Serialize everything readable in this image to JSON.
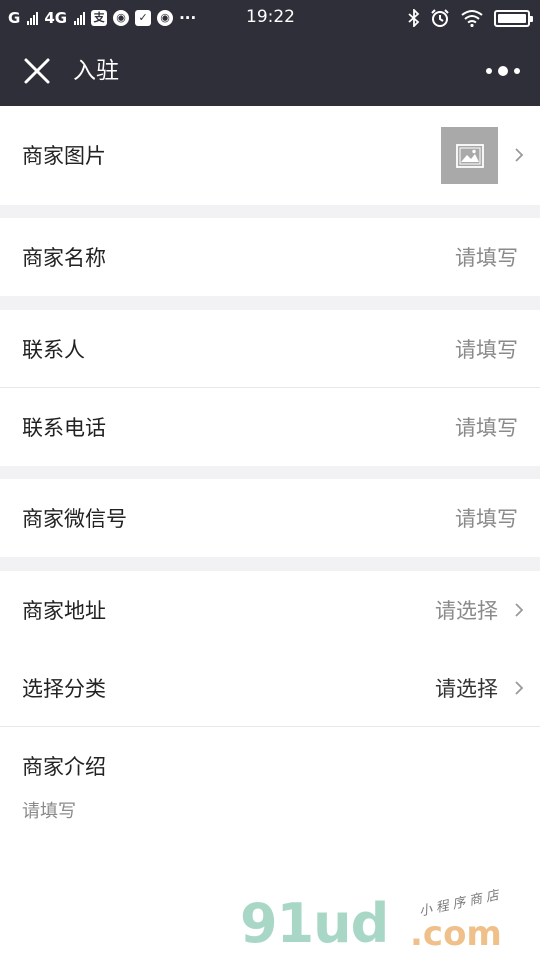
{
  "status_bar": {
    "carrier_1": "G",
    "carrier_2": "4G",
    "time": "19:22",
    "dots": "···"
  },
  "nav": {
    "title": "入驻"
  },
  "form": {
    "merchant_image_label": "商家图片",
    "merchant_name_label": "商家名称",
    "merchant_name_placeholder": "请填写",
    "contact_label": "联系人",
    "contact_placeholder": "请填写",
    "phone_label": "联系电话",
    "phone_placeholder": "请填写",
    "wechat_label": "商家微信号",
    "wechat_placeholder": "请填写",
    "address_label": "商家地址",
    "address_value": "请选择",
    "category_label": "选择分类",
    "category_value": "请选择",
    "intro_label": "商家介绍",
    "intro_placeholder": "请填写"
  },
  "watermark": {
    "logo": "91ud",
    "domain": ".com",
    "tagline": "小程序商店"
  },
  "colors": {
    "header_bg": "#2f2f3a",
    "page_bg": "#f2f2f4",
    "placeholder": "#8a8a8a"
  }
}
